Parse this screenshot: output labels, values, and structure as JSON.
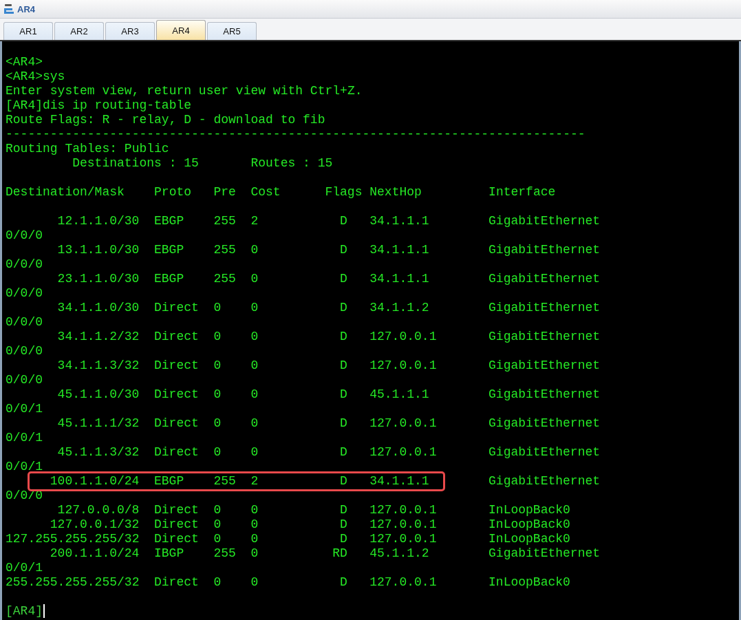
{
  "window": {
    "title": "AR4"
  },
  "tabs": [
    {
      "label": "AR1",
      "selected": false
    },
    {
      "label": "AR2",
      "selected": false
    },
    {
      "label": "AR3",
      "selected": false
    },
    {
      "label": "AR4",
      "selected": true
    },
    {
      "label": "AR5",
      "selected": false
    }
  ],
  "terminal": {
    "lines": [
      "<AR4>",
      "<AR4>sys",
      "Enter system view, return user view with Ctrl+Z.",
      "[AR4]dis ip routing-table",
      "Route Flags: R - relay, D - download to fib",
      "------------------------------------------------------------------------------",
      "Routing Tables: Public"
    ],
    "destinations": "Destinations : 15",
    "routes_count": "Routes : 15",
    "columns": [
      "Destination/Mask",
      "Proto",
      "Pre",
      "Cost",
      "Flags",
      "NextHop",
      "Interface"
    ],
    "routes": [
      {
        "destination": "12.1.1.0/30",
        "proto": "EBGP",
        "pre": "255",
        "cost": "2",
        "flags": "D",
        "nexthop": "34.1.1.1",
        "interface": "GigabitEthernet",
        "interface_continued": "0/0/0",
        "highlighted": false
      },
      {
        "destination": "13.1.1.0/30",
        "proto": "EBGP",
        "pre": "255",
        "cost": "0",
        "flags": "D",
        "nexthop": "34.1.1.1",
        "interface": "GigabitEthernet",
        "interface_continued": "0/0/0",
        "highlighted": false
      },
      {
        "destination": "23.1.1.0/30",
        "proto": "EBGP",
        "pre": "255",
        "cost": "0",
        "flags": "D",
        "nexthop": "34.1.1.1",
        "interface": "GigabitEthernet",
        "interface_continued": "0/0/0",
        "highlighted": false
      },
      {
        "destination": "34.1.1.0/30",
        "proto": "Direct",
        "pre": "0",
        "cost": "0",
        "flags": "D",
        "nexthop": "34.1.1.2",
        "interface": "GigabitEthernet",
        "interface_continued": "0/0/0",
        "highlighted": false
      },
      {
        "destination": "34.1.1.2/32",
        "proto": "Direct",
        "pre": "0",
        "cost": "0",
        "flags": "D",
        "nexthop": "127.0.0.1",
        "interface": "GigabitEthernet",
        "interface_continued": "0/0/0",
        "highlighted": false
      },
      {
        "destination": "34.1.1.3/32",
        "proto": "Direct",
        "pre": "0",
        "cost": "0",
        "flags": "D",
        "nexthop": "127.0.0.1",
        "interface": "GigabitEthernet",
        "interface_continued": "0/0/0",
        "highlighted": false
      },
      {
        "destination": "45.1.1.0/30",
        "proto": "Direct",
        "pre": "0",
        "cost": "0",
        "flags": "D",
        "nexthop": "45.1.1.1",
        "interface": "GigabitEthernet",
        "interface_continued": "0/0/1",
        "highlighted": false
      },
      {
        "destination": "45.1.1.1/32",
        "proto": "Direct",
        "pre": "0",
        "cost": "0",
        "flags": "D",
        "nexthop": "127.0.0.1",
        "interface": "GigabitEthernet",
        "interface_continued": "0/0/1",
        "highlighted": false
      },
      {
        "destination": "45.1.1.3/32",
        "proto": "Direct",
        "pre": "0",
        "cost": "0",
        "flags": "D",
        "nexthop": "127.0.0.1",
        "interface": "GigabitEthernet",
        "interface_continued": "0/0/1",
        "highlighted": false
      },
      {
        "destination": "100.1.1.0/24",
        "proto": "EBGP",
        "pre": "255",
        "cost": "2",
        "flags": "D",
        "nexthop": "34.1.1.1",
        "interface": "GigabitEthernet",
        "interface_continued": "0/0/0",
        "highlighted": true
      },
      {
        "destination": "127.0.0.0/8",
        "proto": "Direct",
        "pre": "0",
        "cost": "0",
        "flags": "D",
        "nexthop": "127.0.0.1",
        "interface": "InLoopBack0",
        "highlighted": false
      },
      {
        "destination": "127.0.0.1/32",
        "proto": "Direct",
        "pre": "0",
        "cost": "0",
        "flags": "D",
        "nexthop": "127.0.0.1",
        "interface": "InLoopBack0",
        "highlighted": false
      },
      {
        "destination": "127.255.255.255/32",
        "proto": "Direct",
        "pre": "0",
        "cost": "0",
        "flags": "D",
        "nexthop": "127.0.0.1",
        "interface": "InLoopBack0",
        "highlighted": false
      },
      {
        "destination": "200.1.1.0/24",
        "proto": "IBGP",
        "pre": "255",
        "cost": "0",
        "flags": "RD",
        "nexthop": "45.1.1.2",
        "interface": "GigabitEthernet",
        "interface_continued": "0/0/1",
        "highlighted": false
      },
      {
        "destination": "255.255.255.255/32",
        "proto": "Direct",
        "pre": "0",
        "cost": "0",
        "flags": "D",
        "nexthop": "127.0.0.1",
        "interface": "InLoopBack0",
        "highlighted": false
      }
    ],
    "prompt": "[AR4]"
  }
}
